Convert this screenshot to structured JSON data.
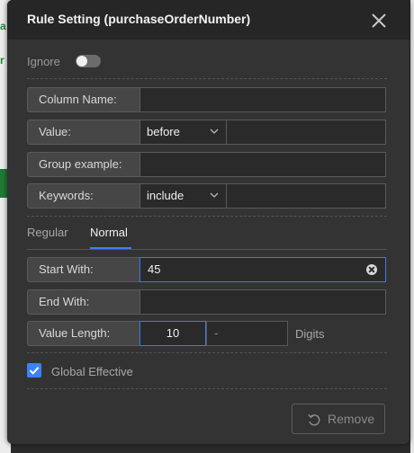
{
  "dialog": {
    "title": "Rule Setting (purchaseOrderNumber)",
    "ignore": {
      "label": "Ignore",
      "on": false
    }
  },
  "fields": {
    "column_name": {
      "label": "Column Name:",
      "value": ""
    },
    "value": {
      "label": "Value:",
      "selected": "before",
      "value": ""
    },
    "group_example": {
      "label": "Group example:",
      "value": ""
    },
    "keywords": {
      "label": "Keywords:",
      "selected": "include",
      "value": ""
    }
  },
  "tabs": [
    {
      "label": "Regular",
      "active": false
    },
    {
      "label": "Normal",
      "active": true
    }
  ],
  "normal": {
    "start_with": {
      "label": "Start With:",
      "value": "45"
    },
    "end_with": {
      "label": "End With:",
      "value": ""
    },
    "value_length": {
      "label": "Value Length:",
      "min": "10",
      "max": "-",
      "unit": "Digits"
    }
  },
  "global_effective": {
    "label": "Global Effective",
    "checked": true
  },
  "footer": {
    "remove_label": "Remove"
  },
  "colors": {
    "accent": "#3b82f6",
    "background": "#333333"
  },
  "icons": {
    "close": "close-icon",
    "clear": "clear-icon",
    "dropdown": "chevron-down-icon",
    "check": "check-icon",
    "remove": "undo-icon"
  }
}
